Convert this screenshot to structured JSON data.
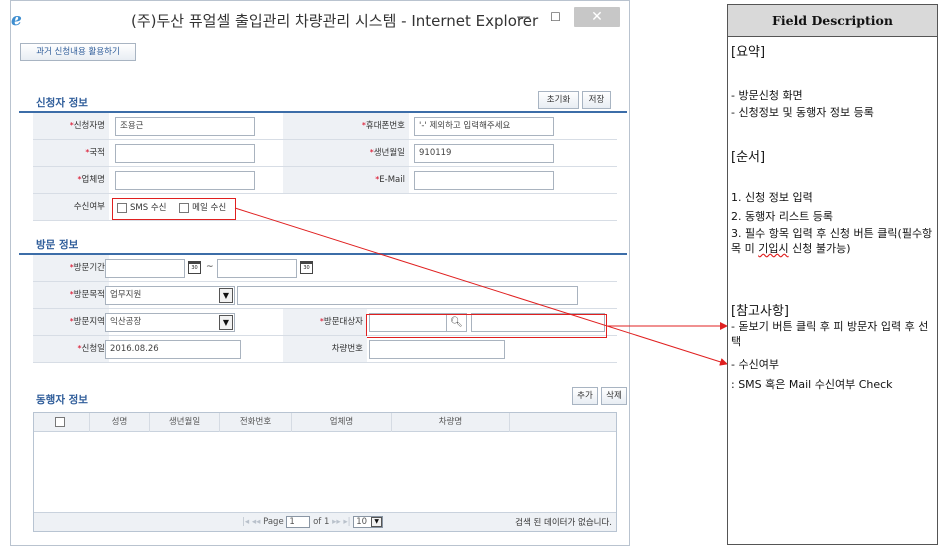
{
  "window": {
    "title": "(주)두산 퓨얼셀 출입관리 차량관리 시스템 - Internet Explorer",
    "min_glyph": "—",
    "max_glyph": "☐",
    "close_glyph": "✕"
  },
  "toolbar": {
    "history_label": "과거 신청내용 활용하기"
  },
  "applicant": {
    "title": "신청자 정보",
    "reset_label": "초기화",
    "save_label": "저장",
    "name_label": "신청자명",
    "name_value": "조용근",
    "phone_label": "휴대폰번호",
    "phone_placeholder": "'-' 제외하고 입력해주세요",
    "nation_label": "국적",
    "nation_value": "",
    "birth_label": "생년월일",
    "birth_value": "910119",
    "company_label": "업체명",
    "company_value": "",
    "email_label": "E-Mail",
    "email_value": "",
    "receive_label": "수신여부",
    "sms_label": "SMS 수신",
    "mail_label": "메일 수신",
    "sms_checked": false,
    "mail_checked": false
  },
  "visit": {
    "title": "방문 정보",
    "period_label": "방문기간",
    "period_from": "",
    "period_to": "",
    "period_sep": "~",
    "purpose_label": "방문목적",
    "purpose_value": "업무지원",
    "purpose_detail": "",
    "area_label": "방문지역",
    "area_value": "익산공장",
    "target_label": "방문대상자",
    "target_value": "",
    "target_detail": "",
    "date_label": "신청일",
    "date_value": "2016.08.26",
    "car_label": "차량번호",
    "car_value": ""
  },
  "companion": {
    "title": "동행자 정보",
    "add_label": "추가",
    "delete_label": "삭제",
    "columns": [
      "성명",
      "생년월일",
      "전화번호",
      "업체명",
      "차량명"
    ],
    "rows": [],
    "pager": {
      "page_label": "Page",
      "page_value": "1",
      "of_label": "of 1",
      "page_size": "10",
      "empty_message": "검색 된 데이터가 없습니다."
    }
  },
  "description": {
    "header": "Field Description",
    "summary_title": "[요약]",
    "summary_1": "- 방문신청 화면",
    "summary_2": "- 신청정보 및 동행자 정보 등록",
    "order_title": "[순서]",
    "order_1": "1. 신청 정보 입력",
    "order_2": "2. 동행자 리스트 등록",
    "order_3a": "3. 필수 항목 입력 후 신청 버튼 클릭(필수항목 미 ",
    "order_3b": "기입시",
    "order_3c": " 신청 불가능)",
    "note_title": "[참고사항]",
    "note_1": "- 돋보기 버튼 클릭 후 피 방문자 입력 후 선택",
    "note_2": "- 수신여부",
    "note_3": ": SMS 혹은 Mail 수신여부 Check"
  },
  "colors": {
    "section_title": "#2f5d9a",
    "required": "#d9001c",
    "annotation_red": "#e02020"
  }
}
